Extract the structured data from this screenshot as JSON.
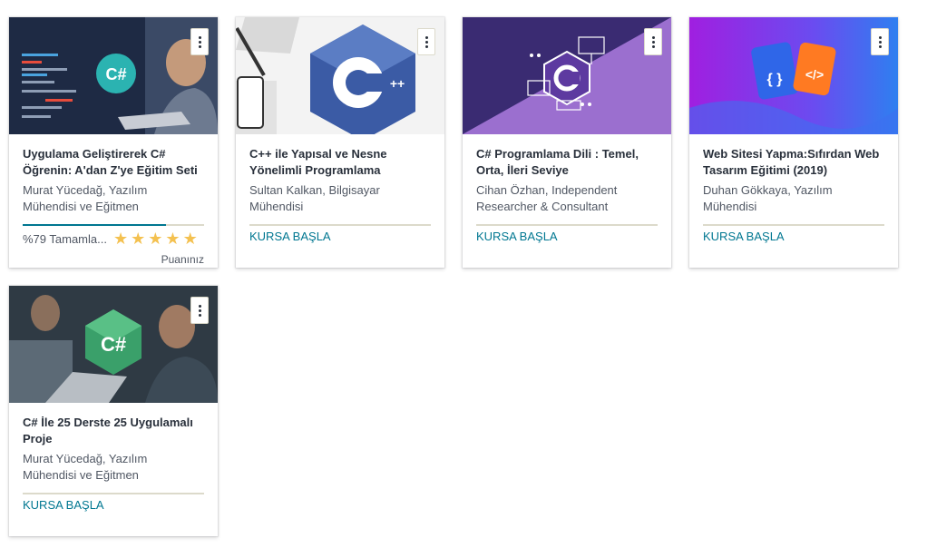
{
  "courses": [
    {
      "title": "Uygulama Geliştirerek C# Öğrenin: A'dan Z'ye Eğitim Seti",
      "instructor": "Murat Yücedağ, Yazılım Mühendisi ve Eğitmen",
      "progress_text": "%79 Tamamla...",
      "progress": 0.79,
      "rating_label": "Puanınız",
      "stars": 5,
      "logo_text": "C#"
    },
    {
      "title": "C++ ile Yapısal ve Nesne Yönelimli Programlama",
      "instructor": "Sultan Kalkan, Bilgisayar Mühendisi",
      "start_label": "KURSA BAŞLA",
      "logo_text": "C++"
    },
    {
      "title": "C# Programlama Dili : Temel, Orta, İleri Seviye",
      "instructor": "Cihan Özhan, Independent Researcher & Consultant",
      "start_label": "KURSA BAŞLA",
      "logo_text": "C#"
    },
    {
      "title": "Web Sitesi Yapma:Sıfırdan Web Tasarım Eğitimi (2019)",
      "instructor": "Duhan Gökkaya, Yazılım Mühendisi",
      "start_label": "KURSA BAŞLA",
      "logo_text": "{ }",
      "logo_text2": "</>"
    },
    {
      "title": "C# İle 25 Derste 25 Uygulamalı Proje",
      "instructor": "Murat Yücedağ, Yazılım Mühendisi ve Eğitmen",
      "start_label": "KURSA BAŞLA",
      "logo_text": "C#"
    }
  ],
  "colors": {
    "accent": "#007791",
    "star": "#f4c150",
    "track": "#dcdacb"
  }
}
